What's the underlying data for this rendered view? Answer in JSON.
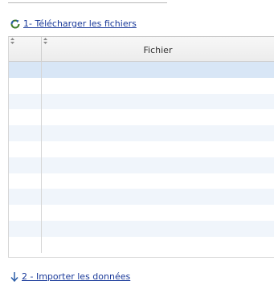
{
  "step1": {
    "label": "1- Télécharger les fichiers",
    "icon": "refresh-icon"
  },
  "grid": {
    "columns": [
      {
        "label": ""
      },
      {
        "label": "Fichier"
      }
    ],
    "rows": [
      {
        "selected": true
      },
      {
        "selected": false
      },
      {
        "selected": false
      },
      {
        "selected": false
      },
      {
        "selected": false
      },
      {
        "selected": false
      },
      {
        "selected": false
      },
      {
        "selected": false
      },
      {
        "selected": false
      },
      {
        "selected": false
      },
      {
        "selected": false
      },
      {
        "selected": false
      }
    ]
  },
  "step2": {
    "label": "2 - Importer les données",
    "icon": "arrow-down-icon"
  },
  "colors": {
    "link": "#1a3a9a",
    "row_alt": "#f0f5fb",
    "row_selected": "#d8e6f6"
  }
}
